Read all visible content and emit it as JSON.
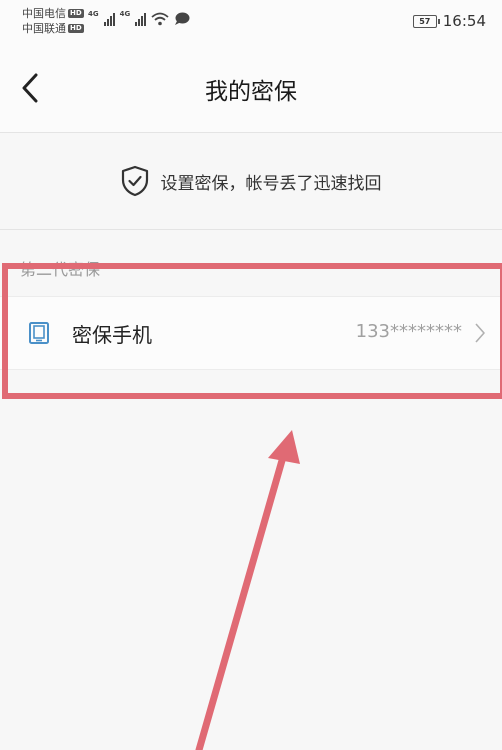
{
  "status_bar": {
    "carrier1": "中国电信",
    "carrier2": "中国联通",
    "hd_badge": "HD",
    "network": "4G",
    "battery": "57",
    "time": "16:54"
  },
  "header": {
    "title": "我的密保"
  },
  "banner": {
    "text": "设置密保，帐号丢了迅速找回",
    "icon": "shield-check-icon"
  },
  "section": {
    "title": "第二代密保"
  },
  "rows": [
    {
      "label": "密保手机",
      "value": "133********",
      "icon": "phone-icon"
    }
  ],
  "annotation": {
    "color": "#e06a74"
  }
}
